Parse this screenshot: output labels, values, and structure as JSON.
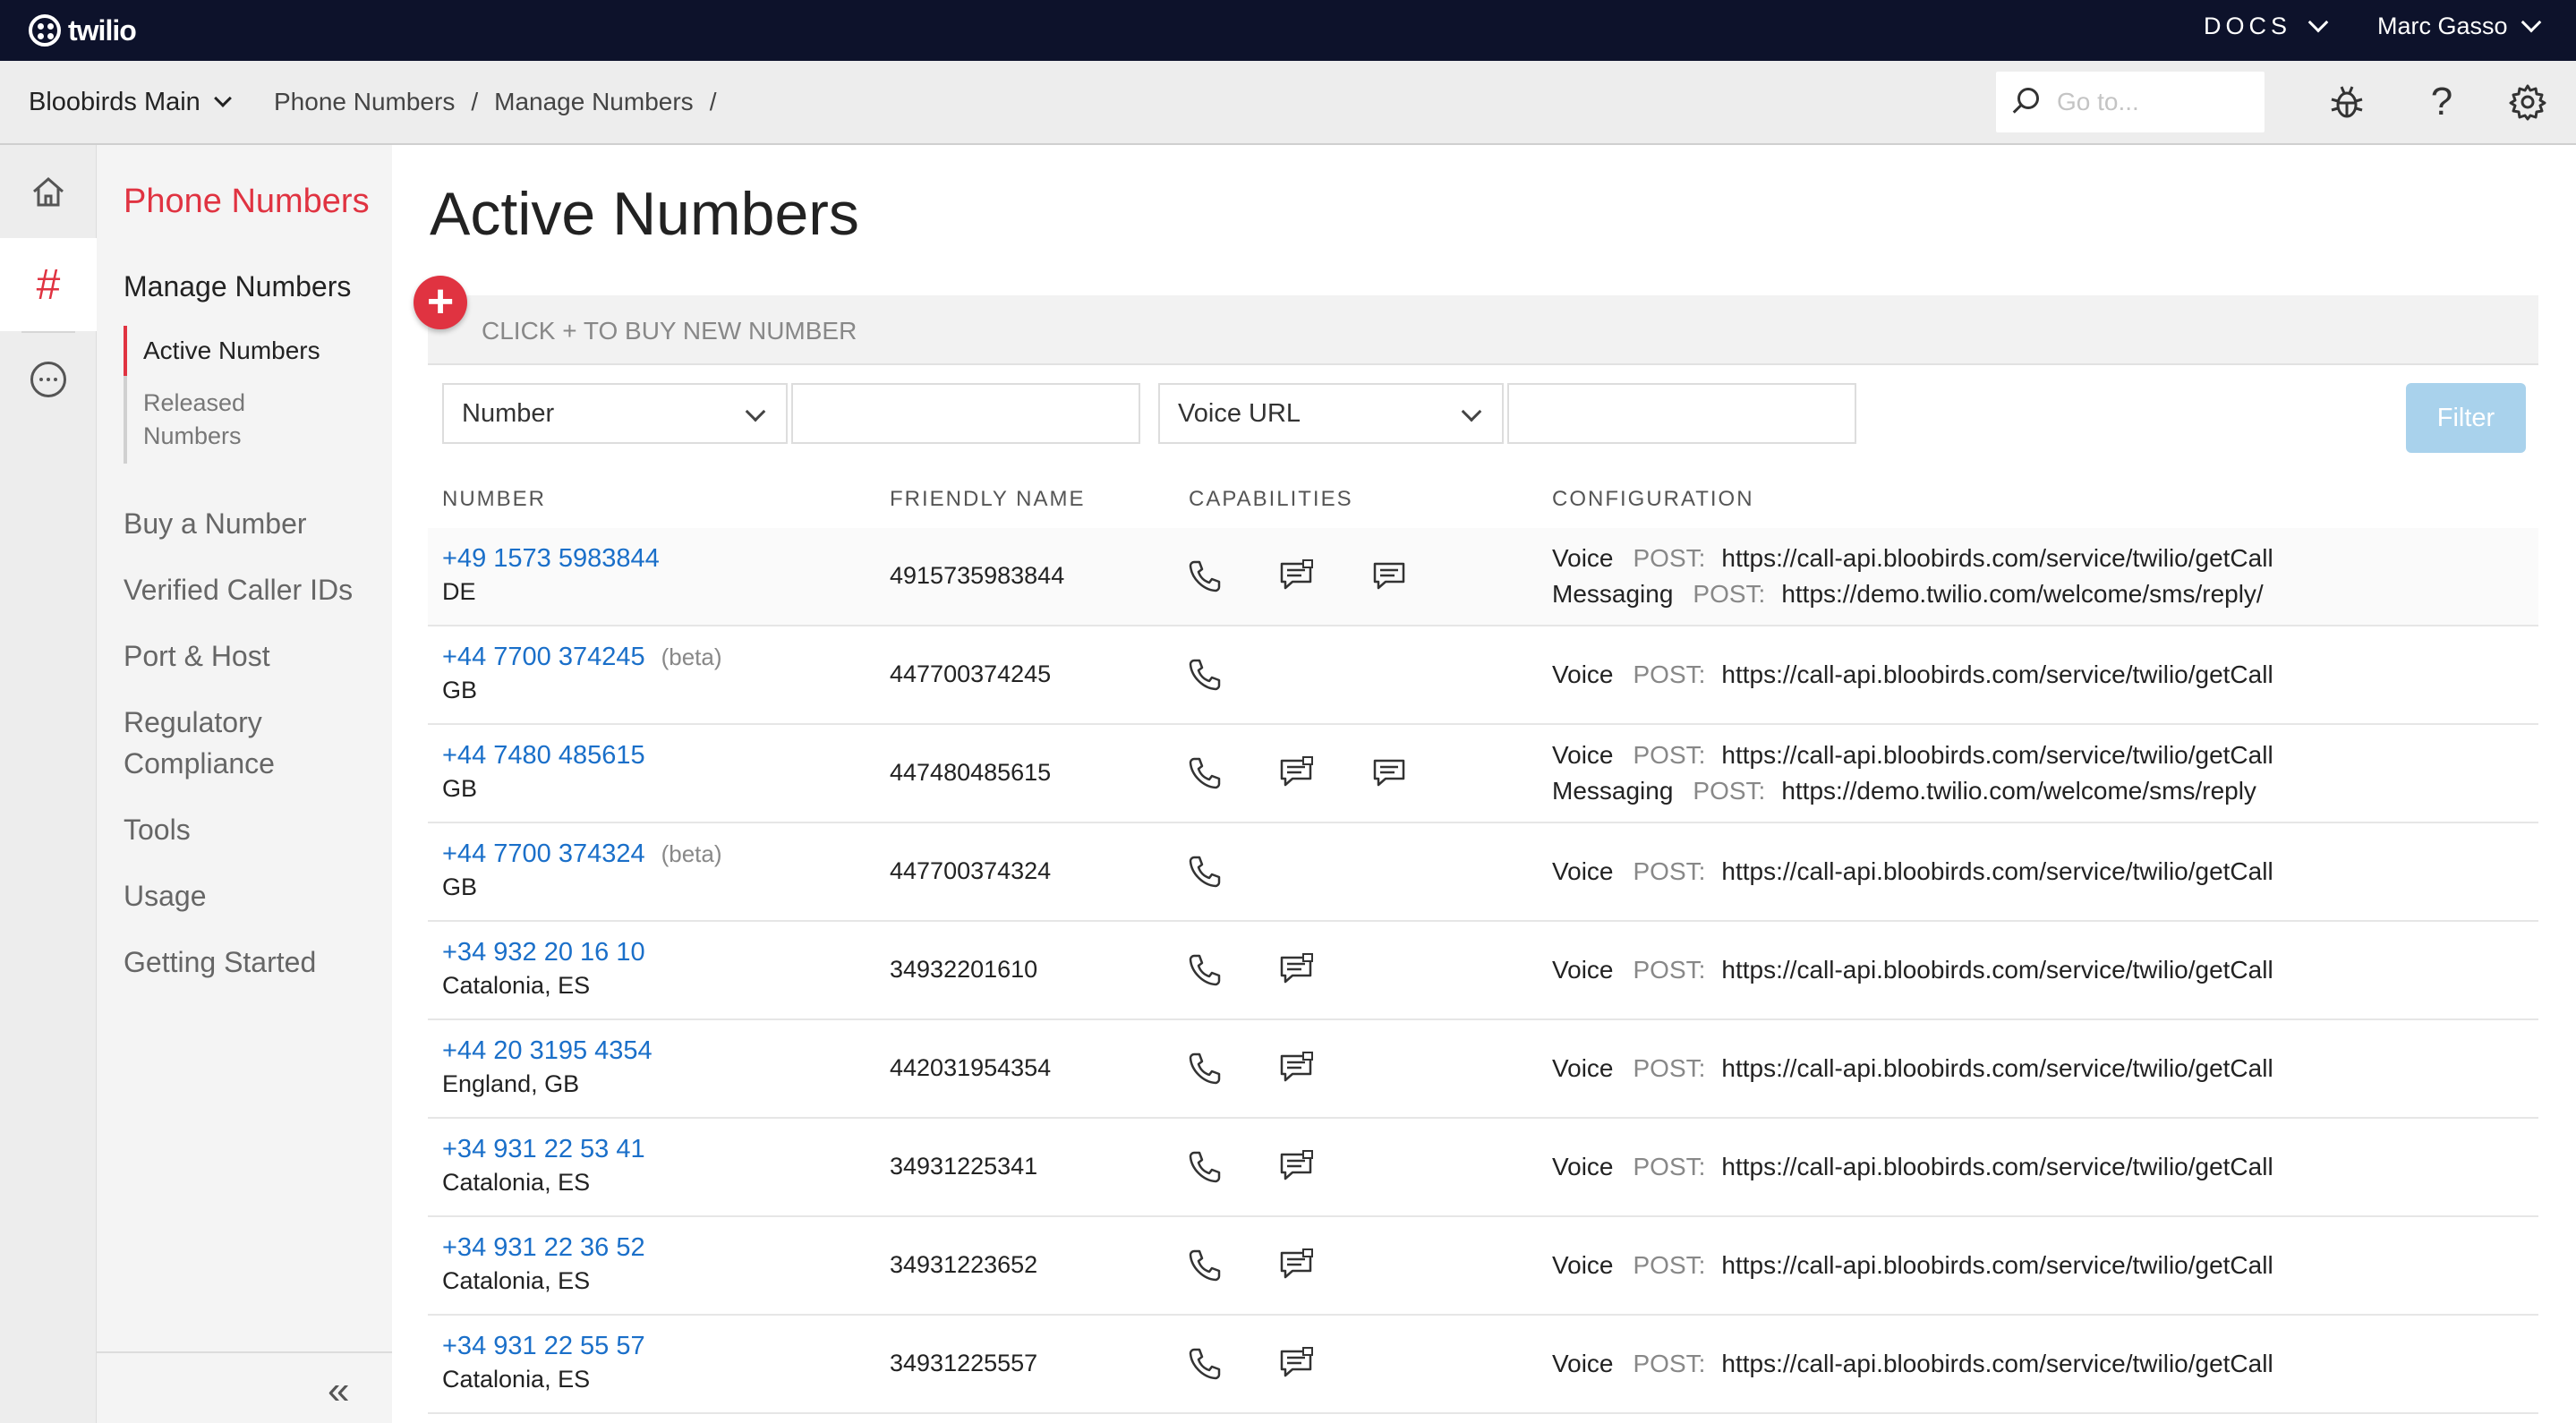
{
  "topbar": {
    "brand": "twilio",
    "docs_label": "DOCS",
    "user_name": "Marc Gasso"
  },
  "subbar": {
    "account": "Bloobirds Main",
    "breadcrumbs": [
      "Phone Numbers",
      "/",
      "Manage Numbers",
      "/"
    ],
    "search_placeholder": "Go to...",
    "help_glyph": "?"
  },
  "rail": {
    "hash_glyph": "#"
  },
  "sidenav": {
    "title": "Phone Numbers",
    "section": "Manage Numbers",
    "active_item": "Active Numbers",
    "released_item": "Released Numbers",
    "links": [
      "Buy a Number",
      "Verified Caller IDs",
      "Port & Host",
      "Regulatory Compliance",
      "Tools",
      "Usage",
      "Getting Started"
    ],
    "collapse_glyph": "«"
  },
  "main": {
    "title": "Active Numbers",
    "buy_plus": "+",
    "buy_hint": "CLICK + TO BUY NEW NUMBER",
    "filter_field": "Number",
    "filter_config": "Voice URL",
    "filter_button": "Filter",
    "columns": [
      "NUMBER",
      "FRIENDLY NAME",
      "CAPABILITIES",
      "CONFIGURATION"
    ]
  },
  "rows": [
    {
      "number": "+49 1573 5983844",
      "beta": "",
      "region": "DE",
      "friendly": "4915735983844",
      "caps": [
        "voice",
        "sms",
        "chat"
      ],
      "config": [
        {
          "kind": "Voice",
          "method": "POST:",
          "url": "https://call-api.bloobirds.com/service/twilio/getCall"
        },
        {
          "kind": "Messaging",
          "method": "POST:",
          "url": "https://demo.twilio.com/welcome/sms/reply/"
        }
      ]
    },
    {
      "number": "+44 7700 374245",
      "beta": "(beta)",
      "region": "GB",
      "friendly": "447700374245",
      "caps": [
        "voice"
      ],
      "config": [
        {
          "kind": "Voice",
          "method": "POST:",
          "url": "https://call-api.bloobirds.com/service/twilio/getCall"
        }
      ]
    },
    {
      "number": "+44 7480 485615",
      "beta": "",
      "region": "GB",
      "friendly": "447480485615",
      "caps": [
        "voice",
        "sms",
        "chat"
      ],
      "config": [
        {
          "kind": "Voice",
          "method": "POST:",
          "url": "https://call-api.bloobirds.com/service/twilio/getCall"
        },
        {
          "kind": "Messaging",
          "method": "POST:",
          "url": "https://demo.twilio.com/welcome/sms/reply"
        }
      ]
    },
    {
      "number": "+44 7700 374324",
      "beta": "(beta)",
      "region": "GB",
      "friendly": "447700374324",
      "caps": [
        "voice"
      ],
      "config": [
        {
          "kind": "Voice",
          "method": "POST:",
          "url": "https://call-api.bloobirds.com/service/twilio/getCall"
        }
      ]
    },
    {
      "number": "+34 932 20 16 10",
      "beta": "",
      "region": "Catalonia, ES",
      "friendly": "34932201610",
      "caps": [
        "voice",
        "sms"
      ],
      "config": [
        {
          "kind": "Voice",
          "method": "POST:",
          "url": "https://call-api.bloobirds.com/service/twilio/getCall"
        }
      ]
    },
    {
      "number": "+44 20 3195 4354",
      "beta": "",
      "region": "England, GB",
      "friendly": "442031954354",
      "caps": [
        "voice",
        "sms"
      ],
      "config": [
        {
          "kind": "Voice",
          "method": "POST:",
          "url": "https://call-api.bloobirds.com/service/twilio/getCall"
        }
      ]
    },
    {
      "number": "+34 931 22 53 41",
      "beta": "",
      "region": "Catalonia, ES",
      "friendly": "34931225341",
      "caps": [
        "voice",
        "sms"
      ],
      "config": [
        {
          "kind": "Voice",
          "method": "POST:",
          "url": "https://call-api.bloobirds.com/service/twilio/getCall"
        }
      ]
    },
    {
      "number": "+34 931 22 36 52",
      "beta": "",
      "region": "Catalonia, ES",
      "friendly": "34931223652",
      "caps": [
        "voice",
        "sms"
      ],
      "config": [
        {
          "kind": "Voice",
          "method": "POST:",
          "url": "https://call-api.bloobirds.com/service/twilio/getCall"
        }
      ]
    },
    {
      "number": "+34 931 22 55 57",
      "beta": "",
      "region": "Catalonia, ES",
      "friendly": "34931225557",
      "caps": [
        "voice",
        "sms"
      ],
      "config": [
        {
          "kind": "Voice",
          "method": "POST:",
          "url": "https://call-api.bloobirds.com/service/twilio/getCall"
        }
      ]
    }
  ]
}
